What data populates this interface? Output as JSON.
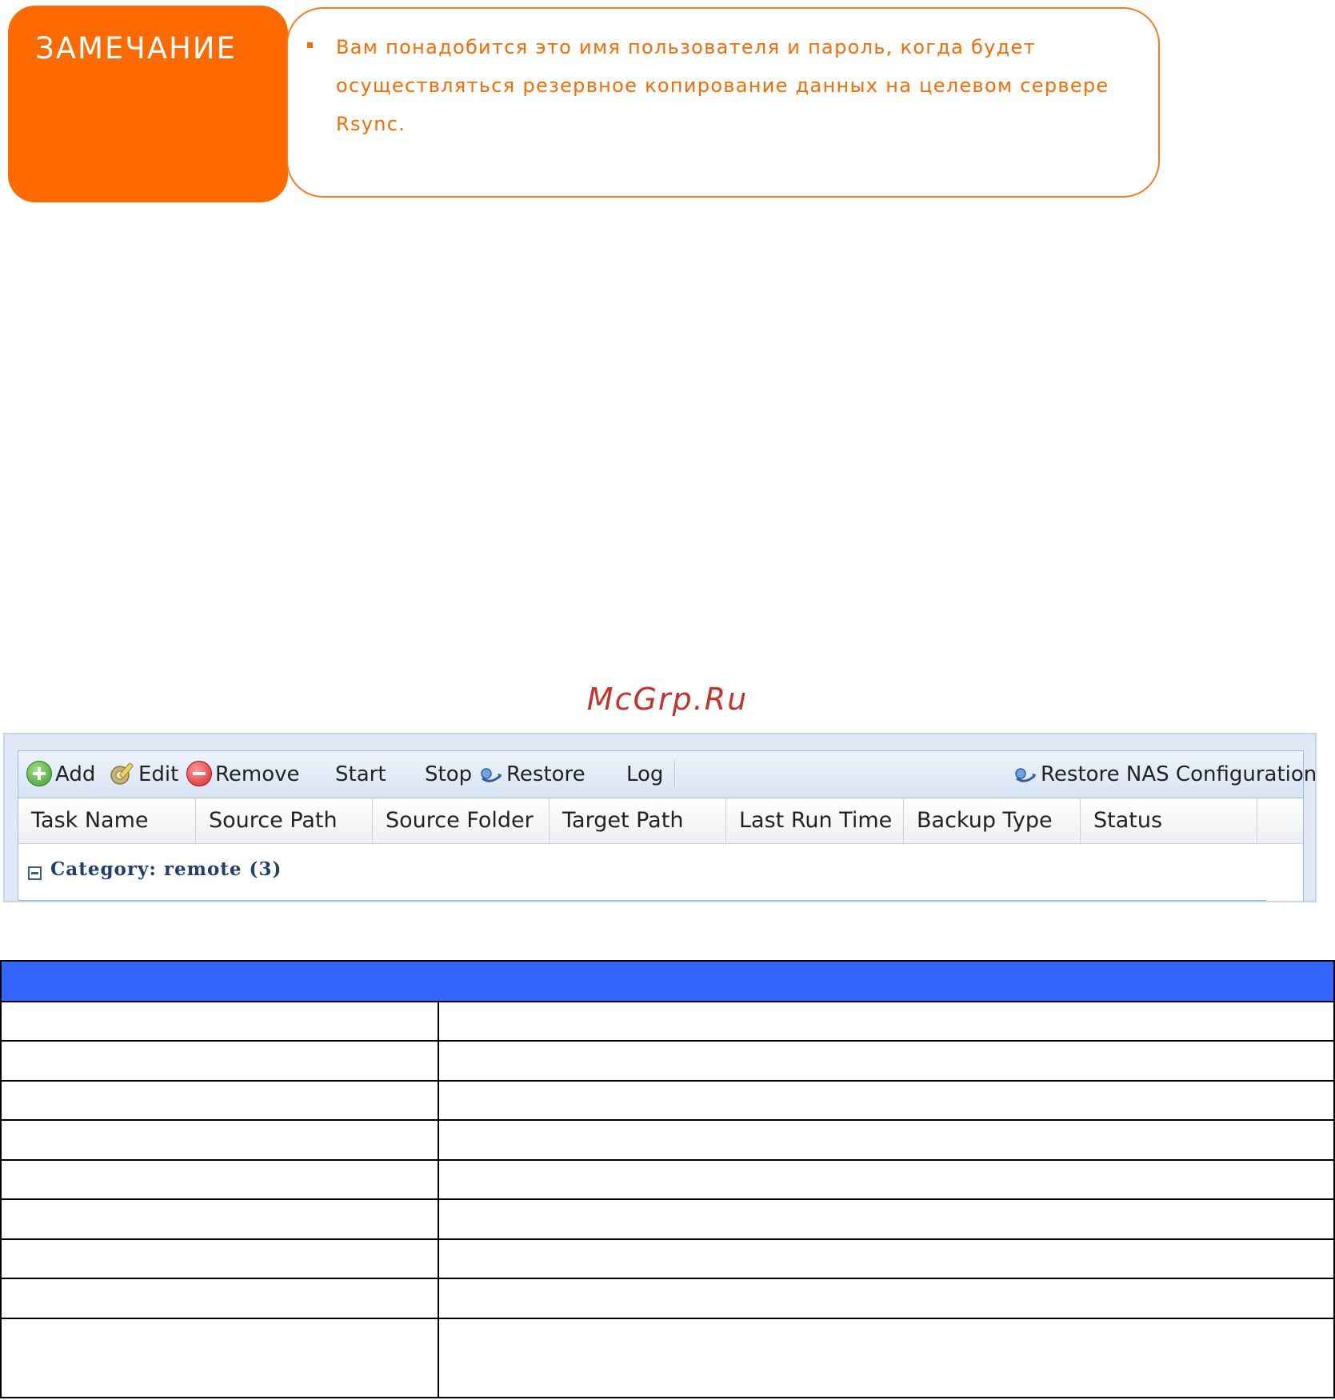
{
  "note": {
    "label": "ЗАМЕЧАНИЕ",
    "text": "Вам понадобится это имя пользователя и пароль, когда будет осуществляться резервное копирование данных на целевом сервере Rsync.",
    "accent_color": "#ff6a00"
  },
  "watermark": "McGrp.Ru",
  "toolbar": {
    "add_label": "Add",
    "edit_label": "Edit",
    "remove_label": "Remove",
    "start_label": "Start",
    "stop_label": "Stop",
    "restore_label": "Restore",
    "log_label": "Log",
    "restore_nas_label": "Restore NAS Configuration",
    "icons": [
      "add-icon",
      "edit-icon",
      "remove-icon",
      "restore-icon",
      "restore-nas-icon"
    ]
  },
  "grid": {
    "columns": [
      "Task Name",
      "Source Path",
      "Source Folder",
      "Target Path",
      "Last Run Time",
      "Backup Type",
      "Status"
    ],
    "group_label": "Category: remote (3)"
  },
  "doc_table": {
    "header_color": "#3366ff"
  }
}
